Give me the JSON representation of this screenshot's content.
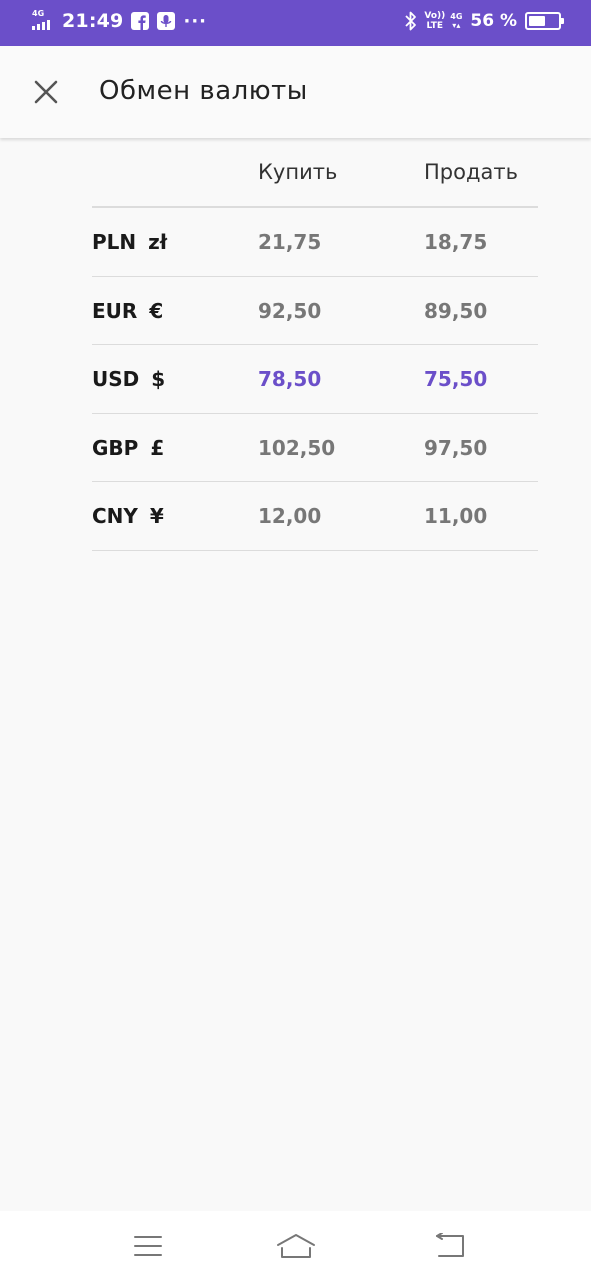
{
  "status_bar": {
    "network_tag": "4G",
    "time": "21:49",
    "more": "···",
    "volte_top": "Vo))",
    "volte_bottom": "LTE",
    "net_top": "4G",
    "net_bottom": "▾▴",
    "battery_percent": "56 %",
    "battery_level": 0.56,
    "color": "#6b4fc9"
  },
  "app_bar": {
    "title": "Обмен валюты",
    "close_icon": "close-icon"
  },
  "rates_table": {
    "headers": {
      "buy": "Купить",
      "sell": "Продать"
    },
    "rows": [
      {
        "code": "PLN",
        "symbol": "zł",
        "buy": "21,75",
        "sell": "18,75",
        "highlighted": false
      },
      {
        "code": "EUR",
        "symbol": "€",
        "buy": "92,50",
        "sell": "89,50",
        "highlighted": false
      },
      {
        "code": "USD",
        "symbol": "$",
        "buy": "78,50",
        "sell": "75,50",
        "highlighted": true
      },
      {
        "code": "GBP",
        "symbol": "£",
        "buy": "102,50",
        "sell": "97,50",
        "highlighted": false
      },
      {
        "code": "CNY",
        "symbol": "¥",
        "buy": "12,00",
        "sell": "11,00",
        "highlighted": false
      }
    ],
    "highlight_color": "#6b4fc9",
    "value_color": "#777777"
  },
  "nav_bar": {
    "icons": [
      "menu-icon",
      "home-icon",
      "back-icon"
    ]
  }
}
